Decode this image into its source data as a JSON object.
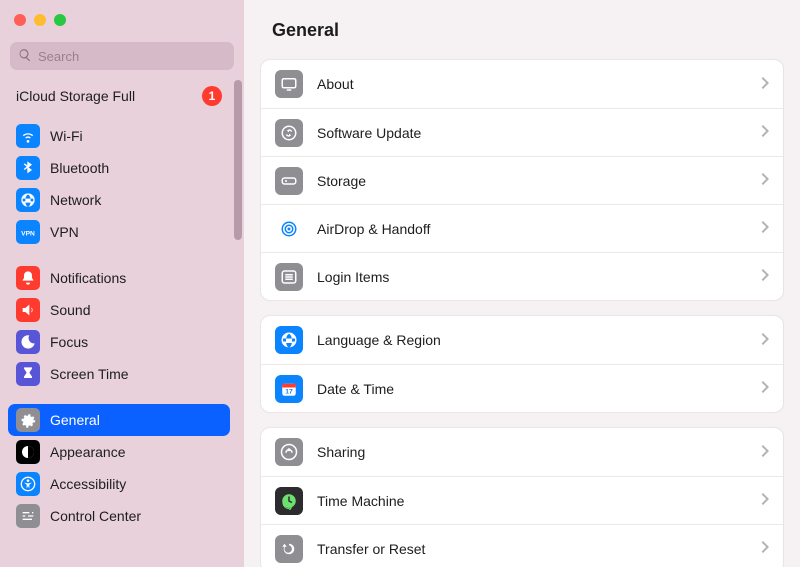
{
  "search": {
    "placeholder": "Search"
  },
  "notice": {
    "text": "iCloud Storage Full",
    "badge": "1"
  },
  "sidebar": {
    "groups": [
      [
        {
          "label": "Wi-Fi",
          "icon": "wifi",
          "bg": "#0a84ff"
        },
        {
          "label": "Bluetooth",
          "icon": "bluetooth",
          "bg": "#0a84ff"
        },
        {
          "label": "Network",
          "icon": "globe",
          "bg": "#0a84ff"
        },
        {
          "label": "VPN",
          "icon": "vpn",
          "bg": "#0a84ff"
        }
      ],
      [
        {
          "label": "Notifications",
          "icon": "bell",
          "bg": "#ff3b30"
        },
        {
          "label": "Sound",
          "icon": "speaker",
          "bg": "#ff3b30"
        },
        {
          "label": "Focus",
          "icon": "moon",
          "bg": "#5856d6"
        },
        {
          "label": "Screen Time",
          "icon": "hourglass",
          "bg": "#5856d6"
        }
      ],
      [
        {
          "label": "General",
          "icon": "gear",
          "bg": "#8e8e93",
          "selected": true
        },
        {
          "label": "Appearance",
          "icon": "appearance",
          "bg": "#000000"
        },
        {
          "label": "Accessibility",
          "icon": "accessibility",
          "bg": "#0a84ff"
        },
        {
          "label": "Control Center",
          "icon": "sliders",
          "bg": "#8e8e93"
        }
      ]
    ]
  },
  "content": {
    "title": "General",
    "groups": [
      [
        {
          "label": "About",
          "icon": "about",
          "bg": "#8e8e93"
        },
        {
          "label": "Software Update",
          "icon": "update",
          "bg": "#8e8e93"
        },
        {
          "label": "Storage",
          "icon": "storage",
          "bg": "#8e8e93"
        },
        {
          "label": "AirDrop & Handoff",
          "icon": "airdrop",
          "bg": "#ffffff",
          "ring": "#0a84ff"
        },
        {
          "label": "Login Items",
          "icon": "list",
          "bg": "#8e8e93"
        }
      ],
      [
        {
          "label": "Language & Region",
          "icon": "globe",
          "bg": "#0a84ff"
        },
        {
          "label": "Date & Time",
          "icon": "calendar",
          "bg": "#0a84ff"
        }
      ],
      [
        {
          "label": "Sharing",
          "icon": "share",
          "bg": "#8e8e93"
        },
        {
          "label": "Time Machine",
          "icon": "clock",
          "bg": "#2c2c2e"
        },
        {
          "label": "Transfer or Reset",
          "icon": "reset",
          "bg": "#8e8e93"
        }
      ]
    ]
  }
}
